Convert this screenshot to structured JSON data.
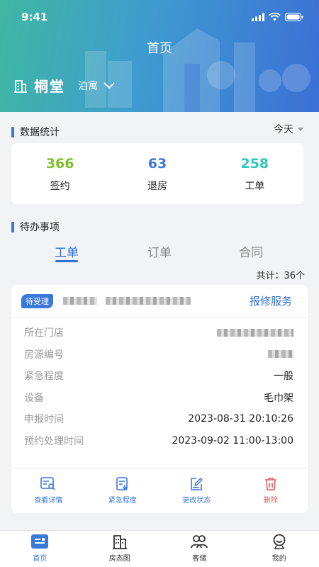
{
  "status_bar": {
    "time": "9:41"
  },
  "header": {
    "title": "首页",
    "store_name": "桐堂",
    "store_type": "泊寓"
  },
  "stats": {
    "section_title": "数据统计",
    "date_filter": "今天",
    "items": [
      {
        "value": "366",
        "label": "签约",
        "color": "#7dc02b"
      },
      {
        "value": "63",
        "label": "退房",
        "color": "#3a78db"
      },
      {
        "value": "258",
        "label": "工单",
        "color": "#2ec7c0"
      }
    ]
  },
  "todo": {
    "section_title": "待办事项",
    "tabs": [
      "工单",
      "订单",
      "合同"
    ],
    "active_tab": "工单",
    "total": "共计：36个"
  },
  "order": {
    "status": "待受理",
    "service_type": "报修服务",
    "fields": [
      {
        "label": "所在门店",
        "value": ""
      },
      {
        "label": "房源编号",
        "value": ""
      },
      {
        "label": "紧急程度",
        "value": "一般"
      },
      {
        "label": "设备",
        "value": "毛巾架"
      },
      {
        "label": "申报时间",
        "value": "2023-08-31 20:10:26"
      },
      {
        "label": "预约处理时间",
        "value": "2023-09-02 11:00-13:00"
      }
    ],
    "actions": [
      {
        "label": "查看详情",
        "icon": "view-detail-icon"
      },
      {
        "label": "紧急程度",
        "icon": "urgency-icon"
      },
      {
        "label": "更改状态",
        "icon": "edit-status-icon"
      },
      {
        "label": "删除",
        "icon": "trash-icon"
      }
    ]
  },
  "bottom_nav": [
    {
      "label": "首页",
      "icon": "home-icon",
      "active": true
    },
    {
      "label": "房态图",
      "icon": "building-icon",
      "active": false
    },
    {
      "label": "客储",
      "icon": "customers-icon",
      "active": false
    },
    {
      "label": "我的",
      "icon": "profile-icon",
      "active": false
    }
  ],
  "colors": {
    "primary": "#3a78db",
    "delete": "#e06060"
  }
}
